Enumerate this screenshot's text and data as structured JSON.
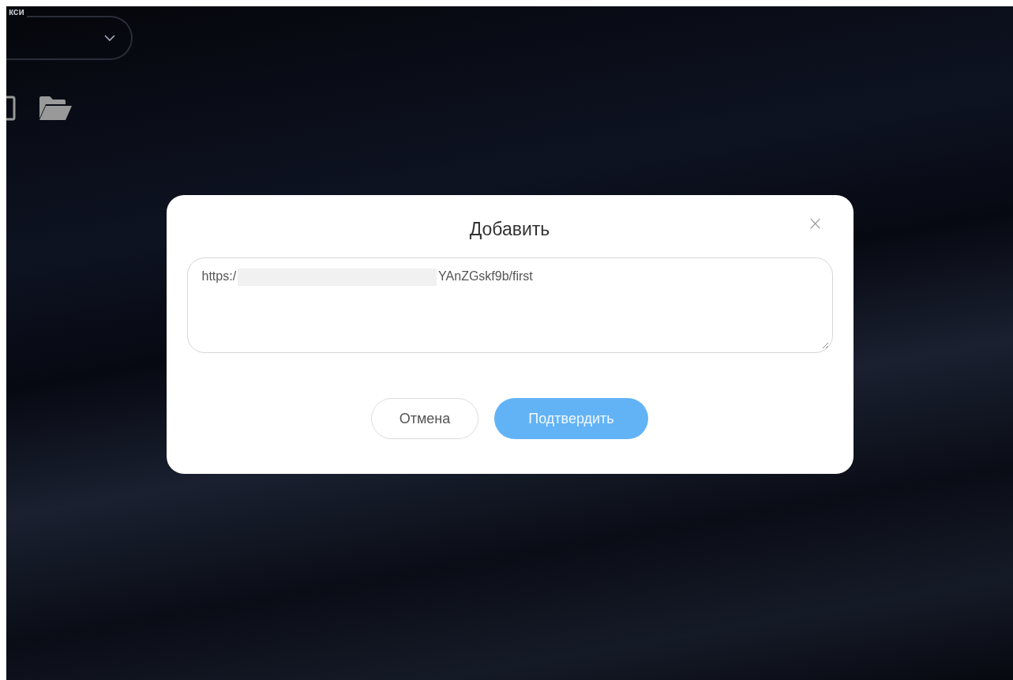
{
  "background_panel": {
    "dropdown_label": "кси"
  },
  "dialog": {
    "title": "Добавить",
    "close": "×",
    "url_field": {
      "value_start": "https:/",
      "redacted": true,
      "value_end": "YAnZGskf9b/first"
    },
    "buttons": [
      {
        "kind": "secondary",
        "label": "Отмена"
      },
      {
        "kind": "primary",
        "label": "Подтвердить",
        "hovered": true
      }
    ]
  }
}
